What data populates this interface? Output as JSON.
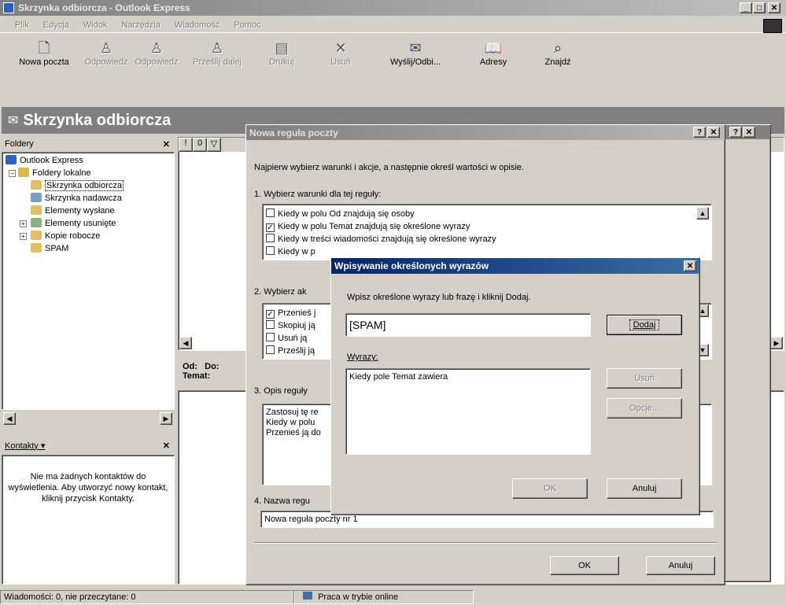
{
  "main_window": {
    "title": "Skrzynka odbiorcza - Outlook Express",
    "menu": [
      "Plik",
      "Edycja",
      "Widok",
      "Narzędzia",
      "Wiadomość",
      "Pomoc"
    ],
    "toolbar": [
      {
        "label": "Nowa poczta",
        "icon": "new-mail-icon",
        "enabled": true
      },
      {
        "label": "Odpowiedz",
        "icon": "reply-icon",
        "enabled": false
      },
      {
        "label": "Odpowiedz",
        "icon": "reply-all-icon",
        "enabled": false
      },
      {
        "label": "Prześlij dalej",
        "icon": "forward-icon",
        "enabled": false
      },
      {
        "label": "Drukuj",
        "icon": "print-icon",
        "enabled": false
      },
      {
        "label": "Usuń",
        "icon": "delete-icon",
        "enabled": false
      },
      {
        "label": "Wyślij/Odbi...",
        "icon": "send-receive-icon",
        "enabled": true
      },
      {
        "label": "Adresy",
        "icon": "address-book-icon",
        "enabled": true
      },
      {
        "label": "Znajdź",
        "icon": "find-icon",
        "enabled": true
      }
    ],
    "banner_title": "Skrzynka odbiorcza"
  },
  "folders": {
    "header": "Foldery",
    "items": [
      "Outlook Express",
      "Foldery lokalne",
      "Skrzynka odbiorcza",
      "Skrzynka nadawcza",
      "Elementy wysłane",
      "Elementy usunięte",
      "Kopie robocze",
      "SPAM"
    ]
  },
  "message_list": {
    "columns": [
      "!",
      "0",
      "▽"
    ],
    "preview_from": "Od:",
    "preview_to": "Do:",
    "preview_subject": "Temat:"
  },
  "contacts": {
    "header": "Kontakty ▾",
    "empty_text": "Nie ma żadnych kontaktów do wyświetlenia. Aby utworzyć nowy kontakt, kliknij przycisk Kontakty."
  },
  "status": {
    "messages": "Wiadomości: 0, nie przeczytane: 0",
    "online": "Praca w trybie online"
  },
  "rule_dialog": {
    "title": "Nowa reguła poczty",
    "intro": "Najpierw wybierz warunki i akcje, a następnie określ wartości w opisie.",
    "section1": "1. Wybierz warunki dla tej reguły:",
    "conditions": [
      {
        "label": "Kiedy w polu Od znajdują się osoby",
        "checked": false
      },
      {
        "label": "Kiedy w polu Temat znajdują się określone wyrazy",
        "checked": true
      },
      {
        "label": "Kiedy w treści wiadomości znajdują się określone wyrazy",
        "checked": false
      },
      {
        "label": "Kiedy w p",
        "checked": false
      }
    ],
    "section2": "2. Wybierz ak",
    "actions": [
      {
        "label": "Przenieś j",
        "checked": true
      },
      {
        "label": "Skopiuj ją",
        "checked": false
      },
      {
        "label": "Usuń ją",
        "checked": false
      },
      {
        "label": "Prześlij ją",
        "checked": false
      }
    ],
    "section3": "3. Opis reguły",
    "description": [
      "Zastosuj tę re",
      "Kiedy w polu",
      "Przenieś ją do"
    ],
    "section4": "4. Nazwa regu",
    "rule_name": "Nowa reguła poczty nr 1",
    "ok": "OK",
    "cancel": "Anuluj"
  },
  "words_dialog": {
    "title": "Wpisywanie określonych wyrazów",
    "instruction": "Wpisz określone wyrazy lub frazę i kliknij Dodaj.",
    "input_value": "[SPAM]",
    "add": "Dodaj",
    "words_label": "Wyrazy:",
    "words_list": [
      "Kiedy pole Temat zawiera"
    ],
    "remove": "Usuń",
    "options": "Opcje...",
    "ok": "OK",
    "cancel": "Anuluj"
  },
  "colors": {
    "title_active": "#0a246a",
    "title_inactive": "#808080",
    "banner": "#808080",
    "face": "#d4d0c8"
  }
}
